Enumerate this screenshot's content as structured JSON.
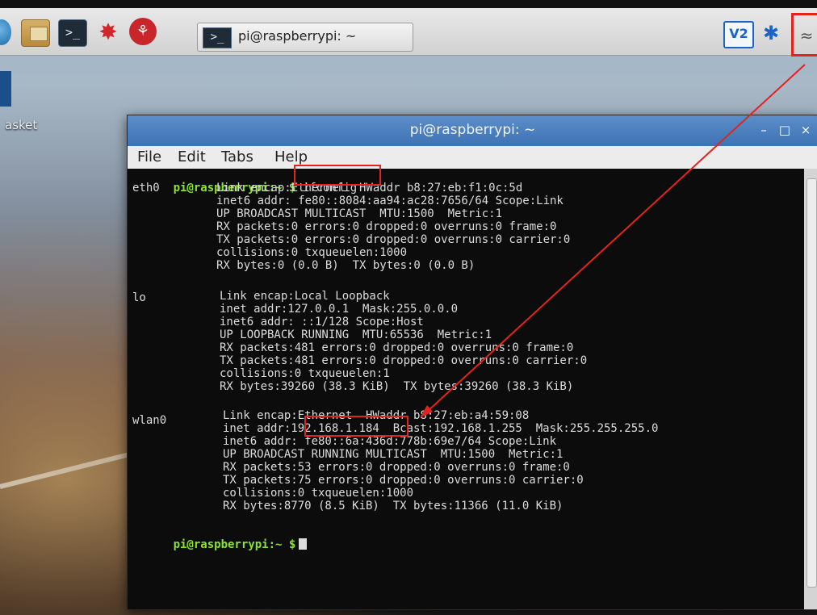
{
  "desktop": {
    "icon_label": "asket"
  },
  "panel": {
    "task_button_label": "pi@raspberrypi: ~",
    "launchers": [
      "globe-icon",
      "file-manager-icon",
      "terminal-icon",
      "mathematica-icon",
      "wolfram-icon"
    ],
    "tray": {
      "vnc": "V2",
      "bluetooth": "✱",
      "wifi": "≈"
    }
  },
  "window": {
    "title": "pi@raspberrypi: ~",
    "controls": {
      "minimize": "–",
      "maximize": "□",
      "close": "×"
    },
    "menu": [
      "File",
      "Edit",
      "Tabs",
      "Help"
    ]
  },
  "terminal": {
    "prompt_user": "pi@raspberrypi:",
    "prompt_path": "~",
    "prompt_symbol": "$",
    "command": "ifconfig",
    "interfaces": [
      {
        "name": "eth0",
        "lines": [
          "Link encap:Ethernet  HWaddr b8:27:eb:f1:0c:5d",
          "inet6 addr: fe80::8084:aa94:ac28:7656/64 Scope:Link",
          "UP BROADCAST MULTICAST  MTU:1500  Metric:1",
          "RX packets:0 errors:0 dropped:0 overruns:0 frame:0",
          "TX packets:0 errors:0 dropped:0 overruns:0 carrier:0",
          "collisions:0 txqueuelen:1000",
          "RX bytes:0 (0.0 B)  TX bytes:0 (0.0 B)"
        ]
      },
      {
        "name": "lo",
        "lines": [
          "Link encap:Local Loopback",
          "inet addr:127.0.0.1  Mask:255.0.0.0",
          "inet6 addr: ::1/128 Scope:Host",
          "UP LOOPBACK RUNNING  MTU:65536  Metric:1",
          "RX packets:481 errors:0 dropped:0 overruns:0 frame:0",
          "TX packets:481 errors:0 dropped:0 overruns:0 carrier:0",
          "collisions:0 txqueuelen:1",
          "RX bytes:39260 (38.3 KiB)  TX bytes:39260 (38.3 KiB)"
        ]
      },
      {
        "name": "wlan0",
        "lines": [
          "Link encap:Ethernet  HWaddr b8:27:eb:a4:59:08",
          "inet addr:192.168.1.184  Bcast:192.168.1.255  Mask:255.255.255.0",
          "inet6 addr: fe80::6a:436d:778b:69e7/64 Scope:Link",
          "UP BROADCAST RUNNING MULTICAST  MTU:1500  Metric:1",
          "RX packets:53 errors:0 dropped:0 overruns:0 frame:0",
          "TX packets:75 errors:0 dropped:0 overruns:0 carrier:0",
          "collisions:0 txqueuelen:1000",
          "RX bytes:8770 (8.5 KiB)  TX bytes:11366 (11.0 KiB)"
        ]
      }
    ]
  },
  "colors": {
    "highlight": "#e4231f",
    "title_bar": "#4a7fbf",
    "prompt": "#8be234"
  }
}
